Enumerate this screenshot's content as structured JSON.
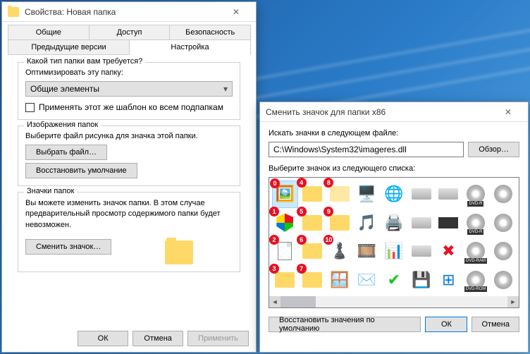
{
  "props": {
    "title": "Свойства: Новая папка",
    "tabs": {
      "general": "Общие",
      "access": "Доступ",
      "security": "Безопасность",
      "prev": "Предыдущие версии",
      "customize": "Настройка"
    },
    "type_section": {
      "legend": "Какой тип папки вам требуется?",
      "optimize": "Оптимизировать эту папку:",
      "combo_value": "Общие элементы",
      "apply_template": "Применять этот же шаблон ко всем подпапкам"
    },
    "images_section": {
      "legend": "Изображения папок",
      "desc": "Выберите файл рисунка для значка этой папки.",
      "select_file": "Выбрать файл…",
      "restore": "Восстановить умолчание"
    },
    "icons_section": {
      "legend": "Значки папок",
      "desc": "Вы можете изменить значок папки. В этом случае предварительный просмотр содержимого папки будет невозможен.",
      "change": "Сменить значок…"
    },
    "buttons": {
      "ok": "ОК",
      "cancel": "Отмена",
      "apply": "Применить"
    }
  },
  "icon_dlg": {
    "title": "Сменить значок для папки x86",
    "search_label": "Искать значки в следующем файле:",
    "path": "C:\\Windows\\System32\\imageres.dll",
    "browse": "Обзор…",
    "list_label": "Выберите значок из следующего списка:",
    "restore": "Восстановить значения по умолчанию",
    "ok": "ОК",
    "cancel": "Отмена",
    "dvd": {
      "r": "DVD-R",
      "rmin": "DVD-R",
      "ram": "DVD-RAM",
      "rom": "DVD-ROM"
    },
    "markers": [
      "0",
      "1",
      "2",
      "3",
      "4",
      "5",
      "6",
      "7",
      "8",
      "9",
      "10"
    ]
  }
}
